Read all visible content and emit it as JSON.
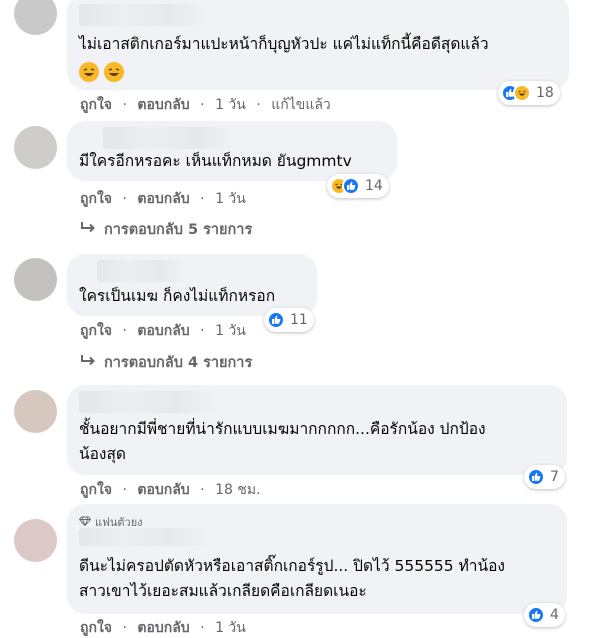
{
  "actions": {
    "like": "ถูกใจ",
    "reply": "ตอบกลับ",
    "edited": "แก้ไขแล้ว",
    "separator": "·"
  },
  "comments": [
    {
      "text_lines": [
        "ไม่เอาสติกเกอร์มาแปะหน้าก็บุญหัวปะ แค่ไม่แท็กนี้คือดีสุดแล้ว"
      ],
      "time": "1 วัน",
      "reaction_count": "18"
    },
    {
      "text_lines": [
        "มีใครอีกหรอคะ เห็นแท็กหมด ยันgmmtv"
      ],
      "time": "1 วัน",
      "reaction_count": "14",
      "replies_label": "การตอบกลับ 5 รายการ"
    },
    {
      "text_lines": [
        "ใครเป็นเมฆ ก็คงไม่แท็กหรอก"
      ],
      "time": "1 วัน",
      "reaction_count": "11",
      "replies_label": "การตอบกลับ 4 รายการ"
    },
    {
      "text_lines": [
        "ชั้นอยากมีพี่ชายที่น่ารักแบบเมฆมากกกกก...คือรักน้อง ปกป้อง",
        "น้องสุด"
      ],
      "time": "18 ชม.",
      "reaction_count": "7"
    },
    {
      "badge": "แฟนตัวยง",
      "text_lines": [
        "ดีนะไม่ครอปตัดหัวหรือเอาสติ๊กเกอร์รูป... ปิดไว้ 555555 ทำน้อง",
        "สาวเขาไว้เยอะสมแล้วเกลียดคือเกลียดเนอะ"
      ],
      "time": "1 วัน",
      "reaction_count": "4"
    }
  ],
  "icons": {
    "like": "like-reaction-icon",
    "haha": "haha-reaction-icon",
    "reply_arrow": "reply-arrow-icon",
    "fan_badge": "diamond-icon"
  },
  "colors": {
    "bubble": "#f0f2f5",
    "secondary_text": "#65676b",
    "like_blue": "#1877f2",
    "haha_yellow": "#f7b928"
  }
}
